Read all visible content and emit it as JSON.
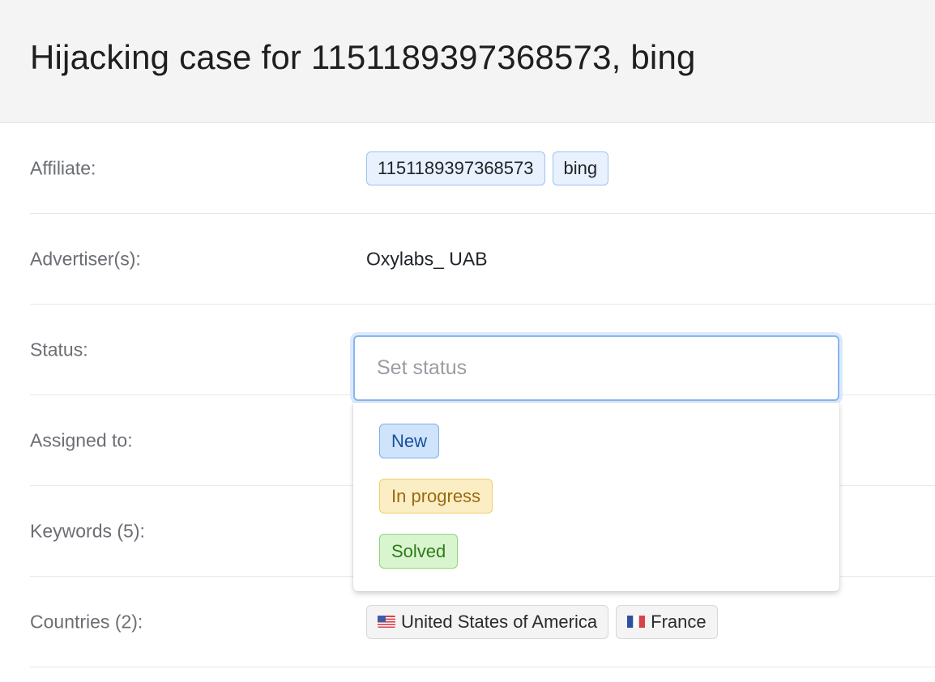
{
  "header": {
    "title": "Hijacking case for 1151189397368573, bing"
  },
  "rows": {
    "affiliate": {
      "label": "Affiliate:",
      "tags": [
        "1151189397368573",
        "bing"
      ]
    },
    "advertiser": {
      "label": "Advertiser(s):",
      "value": "Oxylabs_ UAB"
    },
    "status": {
      "label": "Status:",
      "placeholder": "Set status"
    },
    "assigned": {
      "label": "Assigned to:"
    },
    "keywords": {
      "label": "Keywords (5):"
    },
    "countries": {
      "label": "Countries (2):",
      "items": [
        {
          "name": "United States of America",
          "flag": "us-flag-icon"
        },
        {
          "name": "France",
          "flag": "fr-flag-icon"
        }
      ]
    }
  },
  "status_dropdown": {
    "options": [
      "New",
      "In progress",
      "Solved"
    ],
    "colors": {
      "new": "#cfe3fb",
      "in_progress": "#fbeec4",
      "solved": "#d9f5cf"
    }
  }
}
